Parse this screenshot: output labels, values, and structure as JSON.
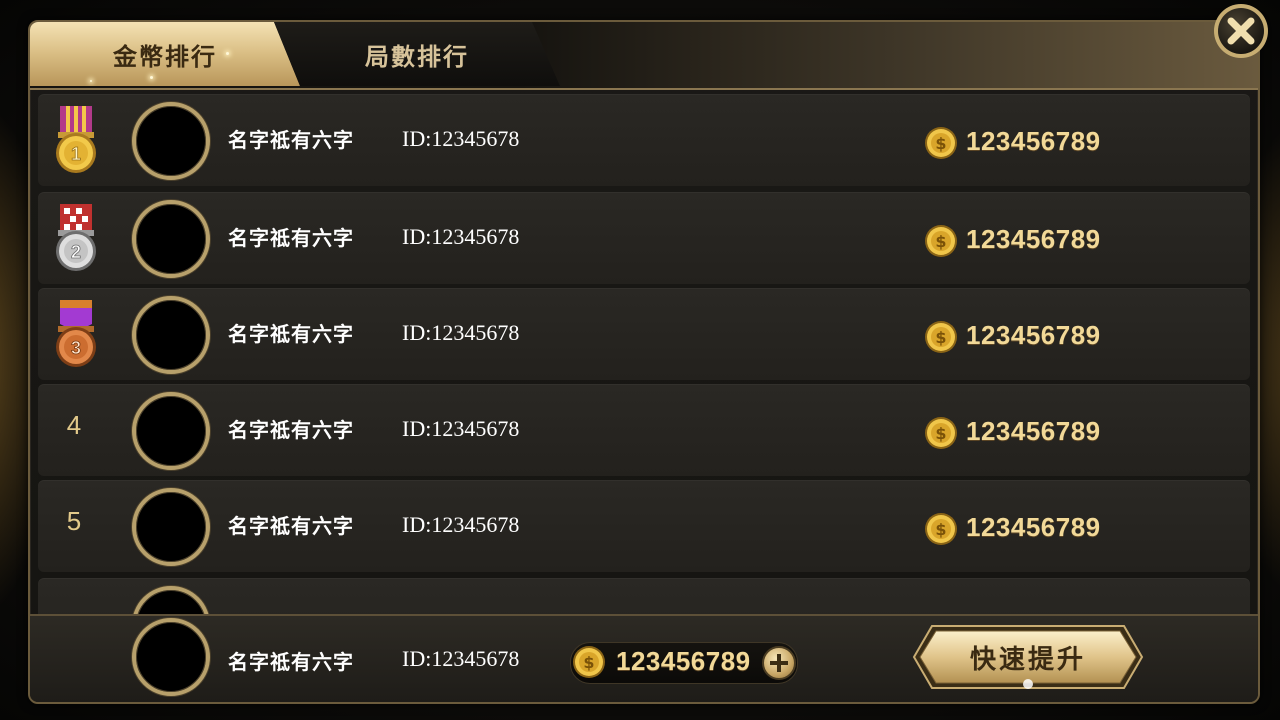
{
  "tabs": [
    {
      "label": "金幣排行",
      "active": true
    },
    {
      "label": "局數排行",
      "active": false
    }
  ],
  "rows": [
    {
      "rank": "1",
      "medal": "gold-medal-icon",
      "name": "名字祗有六字",
      "id": "ID:12345678",
      "coins": "123456789"
    },
    {
      "rank": "2",
      "medal": "silver-medal-icon",
      "name": "名字祗有六字",
      "id": "ID:12345678",
      "coins": "123456789"
    },
    {
      "rank": "3",
      "medal": "bronze-medal-icon",
      "name": "名字祗有六字",
      "id": "ID:12345678",
      "coins": "123456789"
    },
    {
      "rank": "4",
      "medal": null,
      "name": "名字祗有六字",
      "id": "ID:12345678",
      "coins": "123456789"
    },
    {
      "rank": "5",
      "medal": null,
      "name": "名字祗有六字",
      "id": "ID:12345678",
      "coins": "123456789"
    }
  ],
  "self": {
    "name": "名字祗有六字",
    "id": "ID:12345678",
    "coins": "123456789"
  },
  "quick_button": "快速提升",
  "icons": {
    "close": "close-icon",
    "coin": "coin-icon",
    "plus": "plus-icon"
  },
  "colors": {
    "gold": "#f2d998",
    "frame": "#b7a06b",
    "tab_active": "#d9bd83"
  }
}
